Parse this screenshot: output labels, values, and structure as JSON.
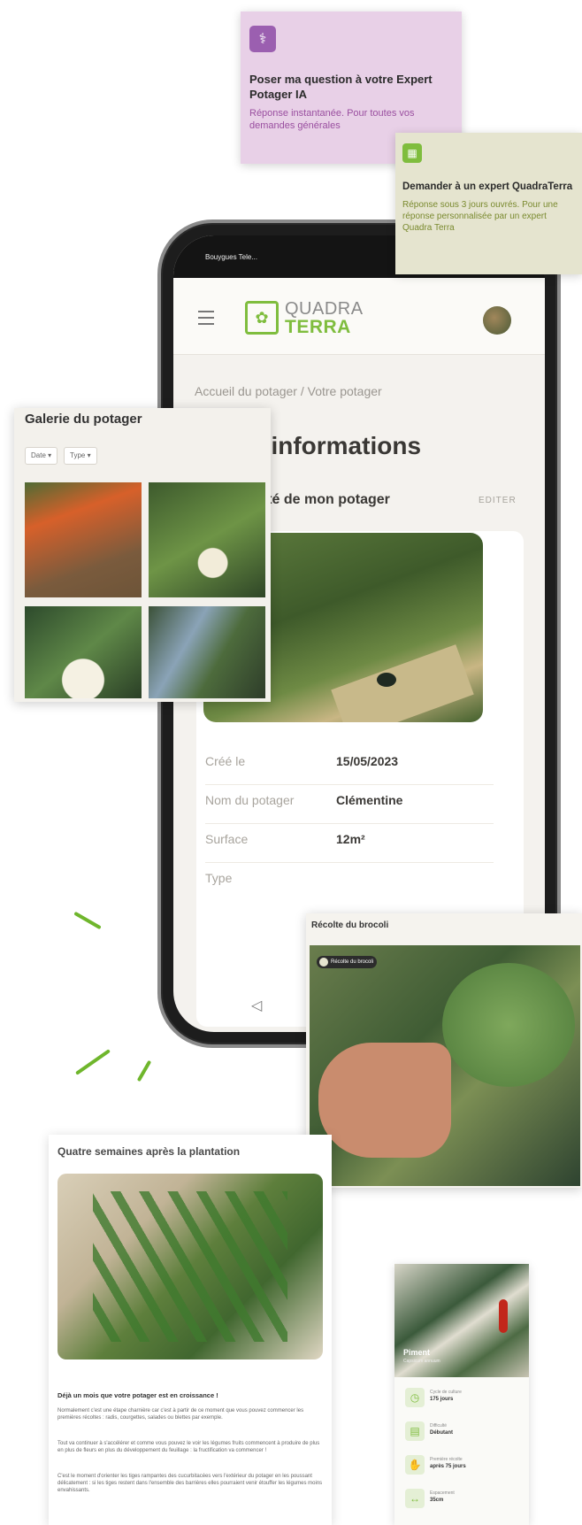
{
  "cards": {
    "ia": {
      "title": "Poser ma question à votre Expert Potager IA",
      "subtitle": "Réponse instantanée. Pour toutes vos demandes générales",
      "icon": "stethoscope-icon"
    },
    "expert": {
      "title": "Demander à un expert QuadraTerra",
      "subtitle": "Réponse sous 3 jours ouvrés. Pour une réponse personnalisée par un expert Quadra Terra",
      "icon": "calendar-icon"
    }
  },
  "phone": {
    "status": "Bouygues Tele...",
    "logo": {
      "top": "QUADRA",
      "bottom": "TERRA"
    },
    "breadcrumb": "Accueil du potager / Votre potager",
    "page_title": "os informations",
    "section_title": "dentité de mon potager",
    "edit_label": "EDITER",
    "rows": [
      {
        "label": "Créé le",
        "value": "15/05/2023"
      },
      {
        "label": "Nom du potager",
        "value": "Clémentine"
      },
      {
        "label": "Surface",
        "value": "12m²"
      },
      {
        "label": "Type",
        "value": ""
      }
    ],
    "nav_back": "◁"
  },
  "gallery": {
    "title": "Galerie du potager",
    "filters": [
      "Date ▾",
      "Type ▾"
    ]
  },
  "brocoli": {
    "title": "Récolte du brocoli",
    "tag": "Récolte du brocoli"
  },
  "article": {
    "title": "Quatre semaines après la plantation",
    "heading": "Déjà un mois que votre potager est en croissance !",
    "paragraphs": [
      "Normalement c'est une étape charnière car c'est à partir de ce moment que vous pouvez commencer les premières récoltes : radis, courgettes, salades ou blettes par exemple.",
      "Tout va continuer à s'accélérer et comme vous pouvez le voir les légumes fruits commencent à produire de plus en plus de fleurs en plus du développement du feuillage : la fructification va commencer !",
      "C'est le moment d'orienter les tiges rampantes des cucurbitacées vers l'extérieur du potager en les poussant délicatement : si les tiges restent dans l'ensemble des barrières elles pourraient venir étouffer les légumes moins envahissants."
    ]
  },
  "plant": {
    "name": "Piment",
    "sub": "Capsicum annuum",
    "rows": [
      {
        "key": "Cycle de culture",
        "value": "175 jours"
      },
      {
        "key": "Difficulté",
        "value": "Débutant"
      },
      {
        "key": "Première récolte",
        "value": "après 75 jours"
      },
      {
        "key": "Espacement",
        "value": "35cm"
      }
    ]
  },
  "colors": {
    "brand_green": "#7fbd3e",
    "ia_purple": "#9b5fb0",
    "expert_card": "#e5e4cf"
  }
}
